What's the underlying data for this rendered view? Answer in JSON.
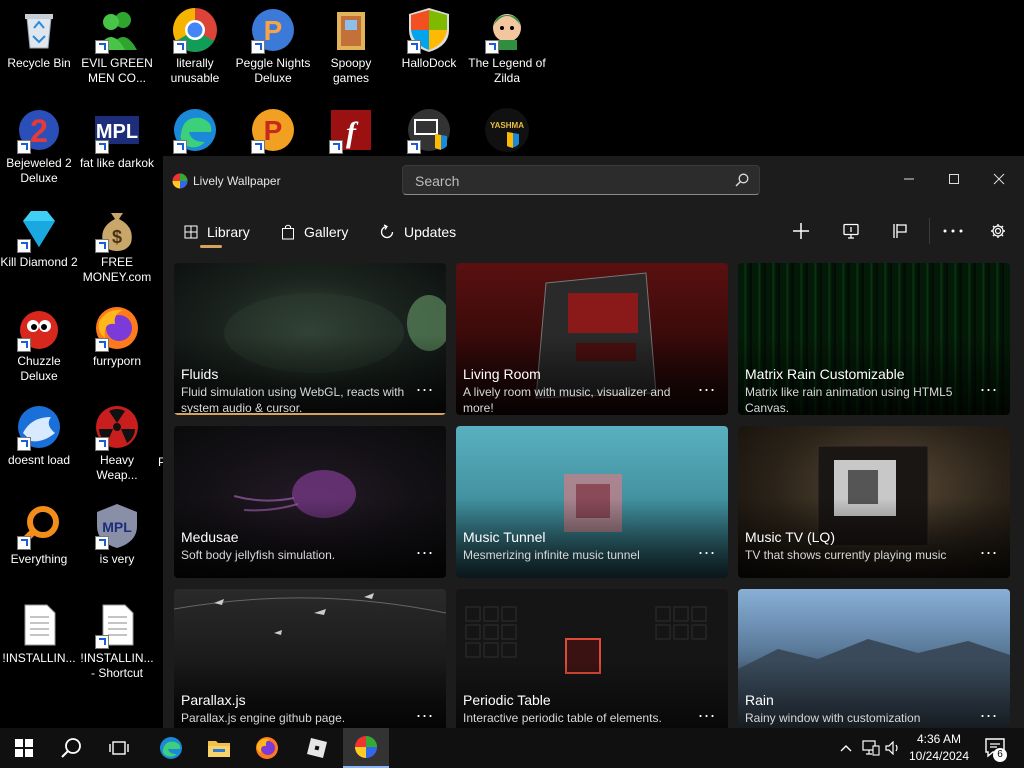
{
  "desktop": {
    "icons": [
      {
        "label": "Recycle Bin"
      },
      {
        "label": "EVIL GREEN MEN CO..."
      },
      {
        "label": "literally unusable"
      },
      {
        "label": "Peggle Nights Deluxe"
      },
      {
        "label": "Spoopy games"
      },
      {
        "label": "HalloDock"
      },
      {
        "label": "The Legend of Zilda"
      },
      {
        "label": "Bejeweled 2 Deluxe"
      },
      {
        "label": "fat like darkok"
      },
      {
        "label": "Kill Diamond 2"
      },
      {
        "label": "FREE MONEY.com"
      },
      {
        "label": "Chuzzle Deluxe"
      },
      {
        "label": "furryporn"
      },
      {
        "label": "doesnt load"
      },
      {
        "label": "Heavy Weap..."
      },
      {
        "label": "Everything"
      },
      {
        "label": "is very"
      },
      {
        "label": "!INSTALLIN..."
      },
      {
        "label": "!INSTALLIN... - Shortcut"
      }
    ],
    "partial_label": "P"
  },
  "window": {
    "title": "Lively Wallpaper",
    "search_placeholder": "Search",
    "tabs": [
      {
        "label": "Library",
        "icon": "grid-icon",
        "active": true
      },
      {
        "label": "Gallery",
        "icon": "bag-icon"
      },
      {
        "label": "Updates",
        "icon": "refresh-icon"
      }
    ],
    "more_label": "...",
    "accent": "#d9a25a"
  },
  "wallpapers": [
    {
      "title": "Fluids",
      "desc": "Fluid simulation using WebGL, reacts with system audio & cursor.",
      "selected": true
    },
    {
      "title": "Living Room",
      "desc": "A lively room with music, visualizer and more!"
    },
    {
      "title": "Matrix Rain Customizable",
      "desc": "Matrix like rain animation using HTML5 Canvas."
    },
    {
      "title": "Medusae",
      "desc": "Soft body jellyfish simulation."
    },
    {
      "title": "Music Tunnel",
      "desc": "Mesmerizing infinite music tunnel"
    },
    {
      "title": "Music TV (LQ)",
      "desc": "TV that shows currently playing music"
    },
    {
      "title": "Parallax.js",
      "desc": "Parallax.js engine github page."
    },
    {
      "title": "Periodic Table",
      "desc": "Interactive periodic table of elements."
    },
    {
      "title": "Rain",
      "desc": "Rainy window with customization"
    }
  ],
  "taskbar": {
    "time": "4:36 AM",
    "date": "10/24/2024",
    "notifications": "6"
  }
}
